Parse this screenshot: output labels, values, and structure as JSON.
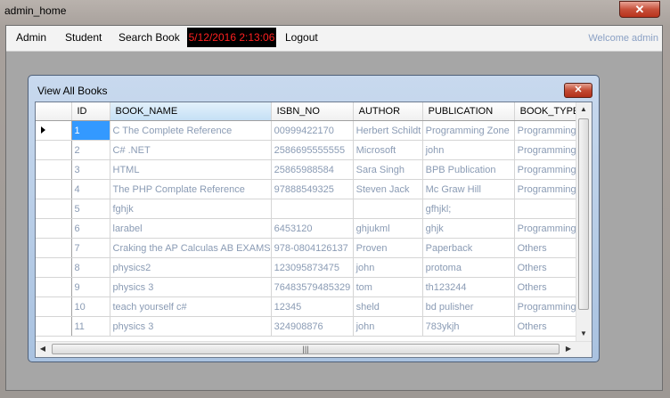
{
  "window": {
    "title": "admin_home",
    "close_glyph": "✕"
  },
  "menu": {
    "items": [
      "Admin",
      "Student",
      "Search Book"
    ],
    "clock": "5/12/2016 2:13:06",
    "logout": "Logout",
    "welcome": "Welcome admin"
  },
  "child": {
    "title": "View All Books",
    "close_glyph": "✕"
  },
  "grid": {
    "columns": [
      "ID",
      "BOOK_NAME",
      "ISBN_NO",
      "AUTHOR",
      "PUBLICATION",
      "BOOK_TYPE"
    ],
    "rows": [
      [
        "1",
        "C The Complete Reference",
        "00999422170",
        "Herbert Schildt",
        "Programming Zone",
        "Programming"
      ],
      [
        "2",
        "C# .NET",
        "2586695555555",
        "Microsoft",
        "john",
        "Programming"
      ],
      [
        "3",
        "HTML",
        "25865988584",
        "Sara Singh",
        "BPB Publication",
        "Programming"
      ],
      [
        "4",
        "The PHP Complate Reference",
        "97888549325",
        "Steven Jack",
        "Mc Graw Hill",
        "Programming"
      ],
      [
        "5",
        "fghjk",
        "",
        "",
        "gfhjkl;",
        ""
      ],
      [
        "6",
        "larabel",
        "6453120",
        "ghjukml",
        "ghjk",
        "Programming"
      ],
      [
        "7",
        "Craking the AP Calculas AB EXAMS",
        "978-0804126137",
        "Proven",
        "Paperback",
        "Others"
      ],
      [
        "8",
        "physics2",
        "123095873475",
        "john",
        "protoma",
        "Others"
      ],
      [
        "9",
        "physics 3",
        "76483579485329",
        "tom",
        "th123244",
        "Others"
      ],
      [
        "10",
        "teach yourself c#",
        "12345",
        "sheld",
        "bd pulisher",
        "Programming"
      ],
      [
        "11",
        "physics 3",
        "324908876",
        "john",
        "783ykjh",
        "Others"
      ]
    ]
  },
  "icons": {
    "row-indicator": "black-triangle",
    "scroll-up": "▲",
    "scroll-down": "▼",
    "scroll-left": "◀",
    "scroll-right": "▶",
    "thumb-grip": "|||"
  }
}
